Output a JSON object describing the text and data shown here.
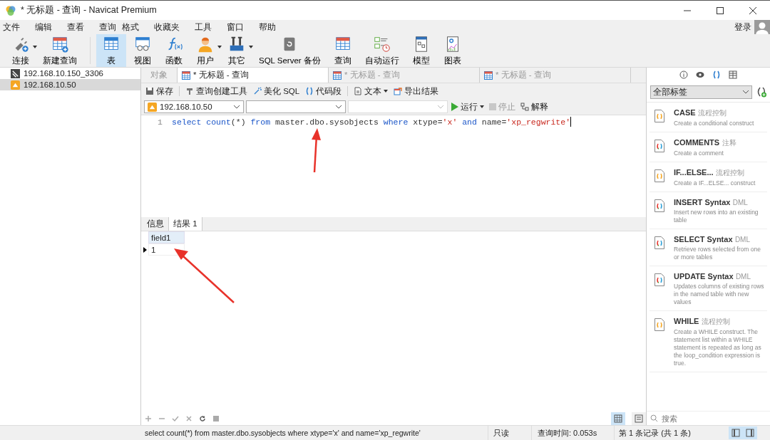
{
  "window": {
    "title": "* 无标题 - 查询 - Navicat Premium"
  },
  "menu": [
    "文件",
    "编辑",
    "查看",
    "查询",
    "格式",
    "收藏夹",
    "工具",
    "窗口",
    "帮助"
  ],
  "login": "登录",
  "toolbar": [
    {
      "kind": "connection",
      "label": "连接",
      "dropdown": true,
      "selected": false
    },
    {
      "kind": "new_query",
      "label": "新建查询",
      "dropdown": false,
      "selected": false
    },
    {
      "kind": "table",
      "label": "表",
      "dropdown": false,
      "selected": true
    },
    {
      "kind": "view",
      "label": "视图",
      "dropdown": false,
      "selected": false
    },
    {
      "kind": "function",
      "label": "函数",
      "dropdown": false,
      "selected": false
    },
    {
      "kind": "user",
      "label": "用户",
      "dropdown": true,
      "selected": false
    },
    {
      "kind": "other",
      "label": "其它",
      "dropdown": true,
      "selected": false
    },
    {
      "kind": "backup",
      "label": "SQL Server 备份",
      "dropdown": false,
      "selected": false
    },
    {
      "kind": "query",
      "label": "查询",
      "dropdown": false,
      "selected": false
    },
    {
      "kind": "automation",
      "label": "自动运行",
      "dropdown": false,
      "selected": false
    },
    {
      "kind": "model",
      "label": "模型",
      "dropdown": false,
      "selected": false
    },
    {
      "kind": "chart",
      "label": "图表",
      "dropdown": false,
      "selected": false
    }
  ],
  "connections": [
    {
      "kind": "mysql",
      "name": "192.168.10.150_3306",
      "selected": false
    },
    {
      "kind": "sqlserver",
      "name": "192.168.10.50",
      "selected": true
    }
  ],
  "tabs": [
    {
      "kind": "objects",
      "label": "对象",
      "selected": false
    },
    {
      "kind": "query",
      "label": "* 无标题 - 查询",
      "selected": true
    },
    {
      "kind": "query",
      "label": "* 无标题 - 查询",
      "selected": false
    },
    {
      "kind": "query",
      "label": "* 无标题 - 查询",
      "selected": false
    }
  ],
  "editor_toolbar": [
    {
      "kind": "save",
      "label": "保存"
    },
    {
      "kind": "builder",
      "label": "查询创建工具"
    },
    {
      "kind": "beautify",
      "label": "美化 SQL"
    },
    {
      "kind": "snippet",
      "label": "代码段"
    },
    {
      "kind": "text",
      "label": "文本",
      "dropdown": true
    },
    {
      "kind": "export",
      "label": "导出结果"
    }
  ],
  "selectors": [
    {
      "value": "192.168.10.50",
      "disabled": false
    },
    {
      "disabled": false
    },
    {
      "disabled": true
    }
  ],
  "run": {
    "label": "运行"
  },
  "stop": {
    "label": "停止",
    "disabled": true
  },
  "explain": {
    "label": "解释"
  },
  "editor": {
    "lines": [
      {
        "number": "1",
        "tokens": [
          {
            "kind": "keyword",
            "text": "select "
          },
          {
            "kind": "keyword",
            "text": "count"
          },
          {
            "kind": "plain",
            "text": "(*) "
          },
          {
            "kind": "keyword",
            "text": "from"
          },
          {
            "kind": "plain",
            "text": " master.dbo.sysobjects "
          },
          {
            "kind": "keyword",
            "text": "where"
          },
          {
            "kind": "plain",
            "text": " xtype="
          },
          {
            "kind": "string",
            "text": "'x' "
          },
          {
            "kind": "keyword",
            "text": "and"
          },
          {
            "kind": "plain",
            "text": " name="
          },
          {
            "kind": "string",
            "text": "'xp_regwrite'"
          }
        ]
      }
    ]
  },
  "result_tabs": [
    {
      "label": "信息",
      "selected": false
    },
    {
      "label": "结果 1",
      "selected": true
    }
  ],
  "results": {
    "columns": [
      "field1"
    ],
    "rows": [
      {
        "cells": [
          "1"
        ],
        "current": true
      }
    ]
  },
  "side_panel": {
    "filter": "全部标签",
    "search_placeholder": "搜索",
    "snippets": [
      {
        "kind": "control",
        "title": "CASE",
        "tag": "流程控制",
        "description": "Create a conditional construct"
      },
      {
        "kind": "syntax",
        "title": "COMMENTS",
        "tag": "注释",
        "description": "Create a comment"
      },
      {
        "kind": "control",
        "title": "IF...ELSE...",
        "tag": "流程控制",
        "description": "Create a IF...ELSE... construct"
      },
      {
        "kind": "syntax",
        "title": "INSERT Syntax",
        "tag": "DML",
        "description": "Insert new rows into an existing table"
      },
      {
        "kind": "syntax",
        "title": "SELECT Syntax",
        "tag": "DML",
        "description": "Retrieve rows selected from one or more tables"
      },
      {
        "kind": "syntax",
        "title": "UPDATE Syntax",
        "tag": "DML",
        "description": "Updates columns of existing rows in the named table with new values"
      },
      {
        "kind": "control",
        "title": "WHILE",
        "tag": "流程控制",
        "description": "Create a WHILE construct. The statement list within a WHILE statement is repeated as long as the loop_condition expression is true."
      }
    ]
  },
  "status_bar": {
    "sql": "select count(*) from master.dbo.sysobjects where xtype='x' and name='xp_regwrite'",
    "mode": "只读",
    "time": "查询时间: 0.053s",
    "records": "第 1 条记录 (共 1 条)"
  }
}
